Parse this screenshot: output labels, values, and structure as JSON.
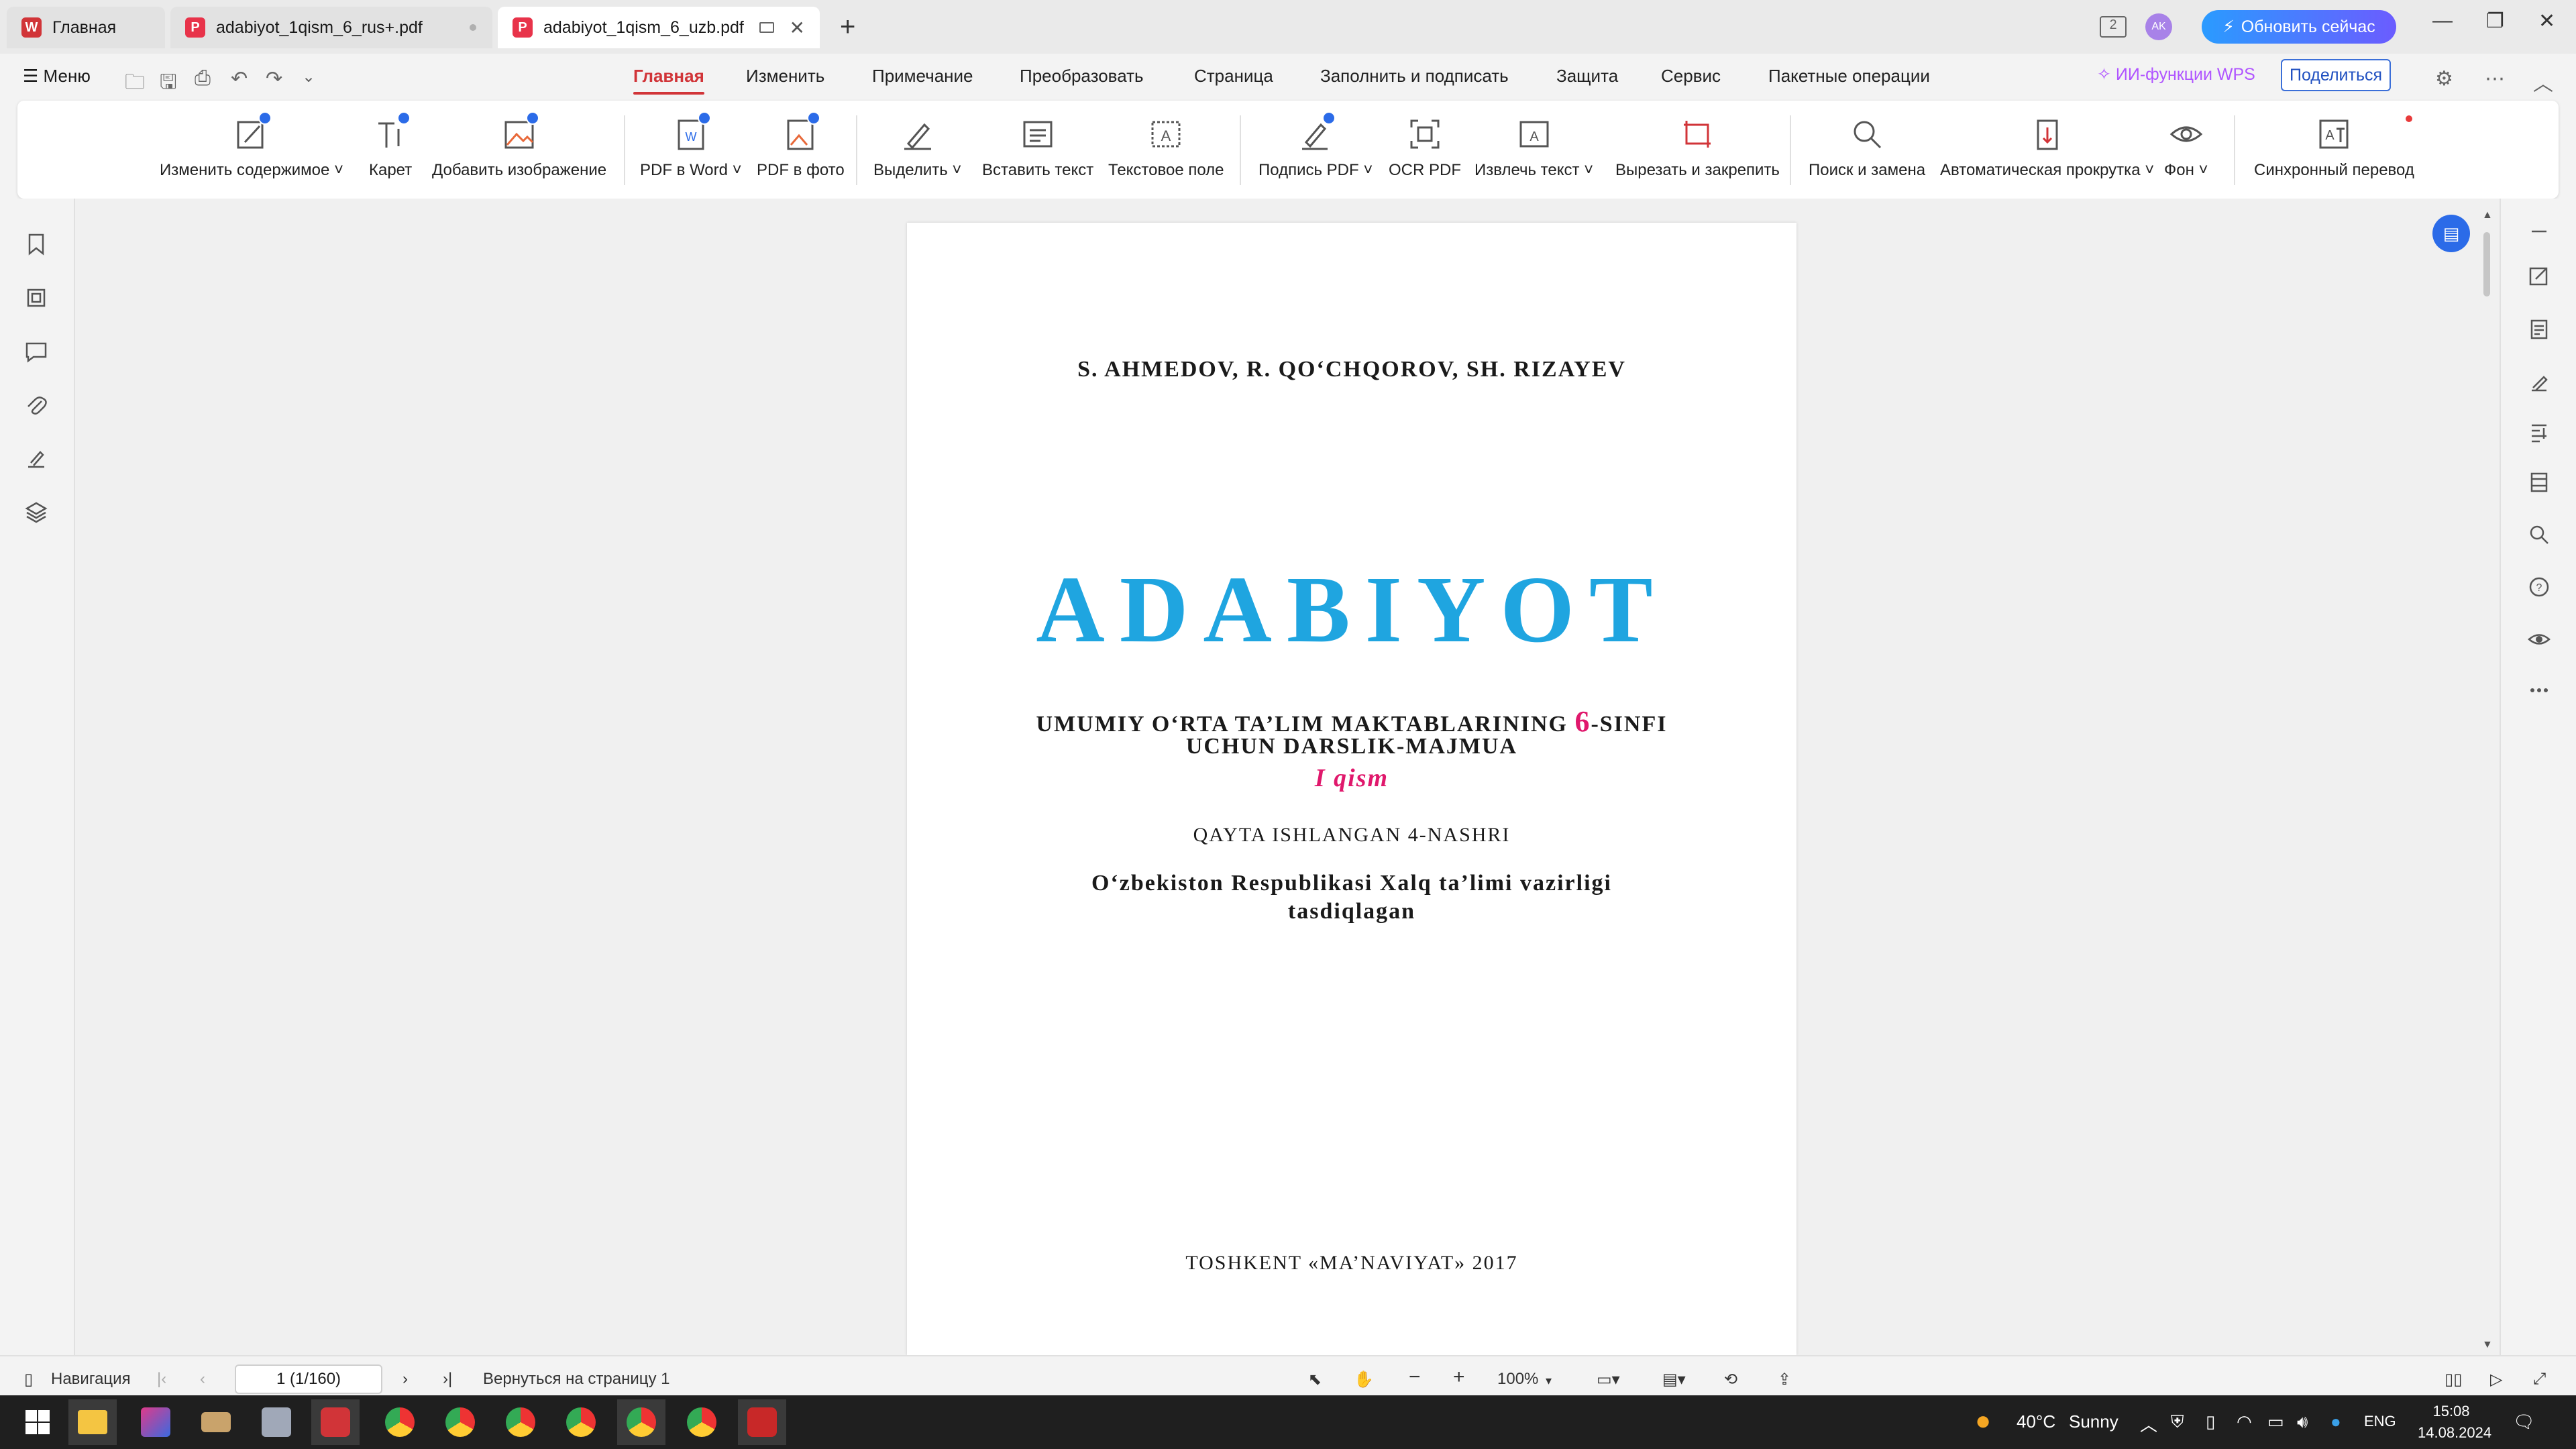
{
  "tabs": [
    {
      "label": "Главная"
    },
    {
      "label": "adabiyot_1qism_6_rus+.pdf"
    },
    {
      "label": "adabiyot_1qism_6_uzb.pdf"
    }
  ],
  "titlebar": {
    "upgrade_label": "Обновить сейчас",
    "avatar": "AK",
    "task_badge": "2"
  },
  "menu": {
    "menu_label": "Меню",
    "items": [
      "Главная",
      "Изменить",
      "Примечание",
      "Преобразовать",
      "Страница",
      "Заполнить и подписать",
      "Защита",
      "Сервис",
      "Пакетные операции"
    ],
    "ai_label": "ИИ-функции WPS",
    "share_label": "Поделиться"
  },
  "ribbon": {
    "items": [
      {
        "label": "Изменить содержимое ˅",
        "icon": "edit-content-icon"
      },
      {
        "label": "Карет",
        "icon": "caret-text-icon"
      },
      {
        "label": "Добавить изображение",
        "icon": "add-image-icon"
      },
      {
        "label": "PDF в Word ˅",
        "icon": "pdf-to-word-icon"
      },
      {
        "label": "PDF в фото",
        "icon": "pdf-to-image-icon"
      },
      {
        "label": "Выделить ˅",
        "icon": "highlight-icon"
      },
      {
        "label": "Вставить текст",
        "icon": "insert-text-icon"
      },
      {
        "label": "Текстовое поле",
        "icon": "text-box-icon"
      },
      {
        "label": "Подпись PDF ˅",
        "icon": "pdf-signature-icon"
      },
      {
        "label": "OCR PDF",
        "icon": "ocr-icon"
      },
      {
        "label": "Извлечь текст ˅",
        "icon": "extract-text-icon"
      },
      {
        "label": "Вырезать и закрепить",
        "icon": "cut-pin-icon"
      },
      {
        "label": "Поиск и замена",
        "icon": "search-replace-icon"
      },
      {
        "label": "Автоматическая прокрутка ˅",
        "icon": "auto-scroll-icon"
      },
      {
        "label": "Фон ˅",
        "icon": "background-eye-icon"
      },
      {
        "label": "Синхронный перевод",
        "icon": "translate-icon"
      }
    ]
  },
  "document": {
    "authors": "S. AHMEDOV, R. QO‘CHQOROV, SH. RIZAYEV",
    "title": "ADABIYOT",
    "subtitle_line1_before": "UMUMIY O‘RTA TA’LIM MAKTABLARINING ",
    "subtitle_grade": "6",
    "subtitle_line1_after": "-SINFI",
    "subtitle_line2": "UCHUN DARSLIK-MAJMUA",
    "part": "I qism",
    "edition": "QAYTA ISHLANGAN 4-NASHRI",
    "approved_line1": "O‘zbekiston Respublikasi Xalq ta’limi vazirligi",
    "approved_line2": "tasdiqlagan",
    "publisher": "TOSHKENT «MA’NAVIYAT» 2017"
  },
  "statusbar": {
    "nav_label": "Навигация",
    "page_value": "1 (1/160)",
    "return_label": "Вернуться на страницу 1",
    "zoom": "100%"
  },
  "taskbar": {
    "weather_temp": "40°C",
    "weather_text": "Sunny",
    "language": "ENG",
    "time": "15:08",
    "date": "14.08.2024"
  },
  "colors": {
    "title_blue": "#1fa5e0",
    "accent_pink": "#e0186c",
    "active_tab_red": "#d13438"
  }
}
